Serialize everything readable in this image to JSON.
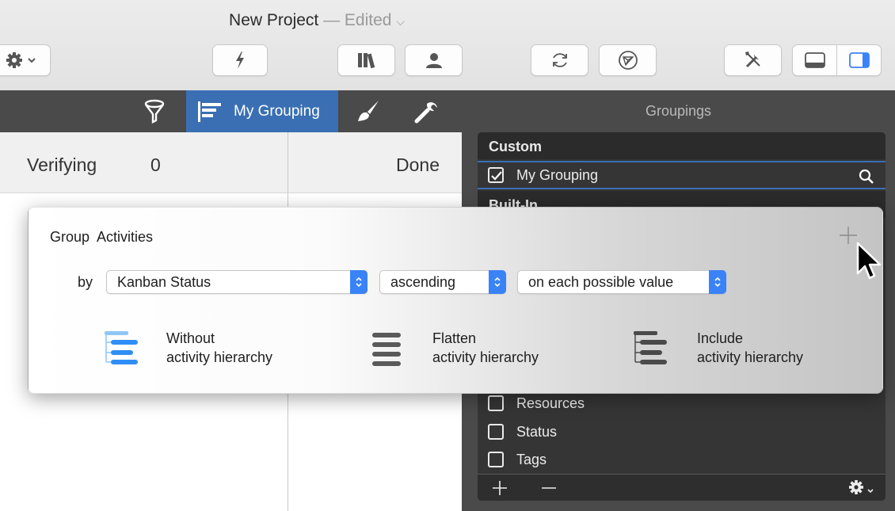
{
  "window": {
    "title": "New Project",
    "edited_label": "— Edited"
  },
  "toolbar": {
    "icons": [
      "gear-icon",
      "lightning-icon",
      "library-icon",
      "person-icon",
      "refresh-icon",
      "network-icon",
      "tools-icon",
      "bottom-panel-icon",
      "right-panel-icon"
    ]
  },
  "view_bar": {
    "active_grouping": "My Grouping",
    "icons": [
      "filter-icon",
      "grouping-icon",
      "brush-icon",
      "wrench-icon"
    ]
  },
  "board": {
    "columns": [
      {
        "title": "Verifying",
        "count": "0"
      },
      {
        "title": "Done"
      }
    ]
  },
  "groupings_panel": {
    "title": "Groupings",
    "custom_header": "Custom",
    "custom_items": [
      {
        "label": "My Grouping",
        "checked": true
      }
    ],
    "builtin_header": "Built-In",
    "builtin_items": [
      {
        "label": "Resources",
        "checked": false
      },
      {
        "label": "Status",
        "checked": false
      },
      {
        "label": "Tags",
        "checked": false
      }
    ],
    "footer_icons": [
      "add-icon",
      "remove-icon",
      "gear-menu-icon"
    ]
  },
  "popover": {
    "title": "Group  Activities",
    "by_label": "by",
    "field_value": "Kanban Status",
    "order_value": "ascending",
    "mode_value": "on each possible value",
    "options": [
      {
        "line1": "Without",
        "line2": "activity hierarchy",
        "selected": true
      },
      {
        "line1": "Flatten",
        "line2": "activity hierarchy",
        "selected": false
      },
      {
        "line1": "Include",
        "line2": "activity hierarchy",
        "selected": false
      }
    ]
  },
  "colors": {
    "accent": "#3a82f7",
    "selected_tab": "#3a6fb3",
    "dark_panel": "#4a4a4a",
    "list_bg": "#353535"
  }
}
